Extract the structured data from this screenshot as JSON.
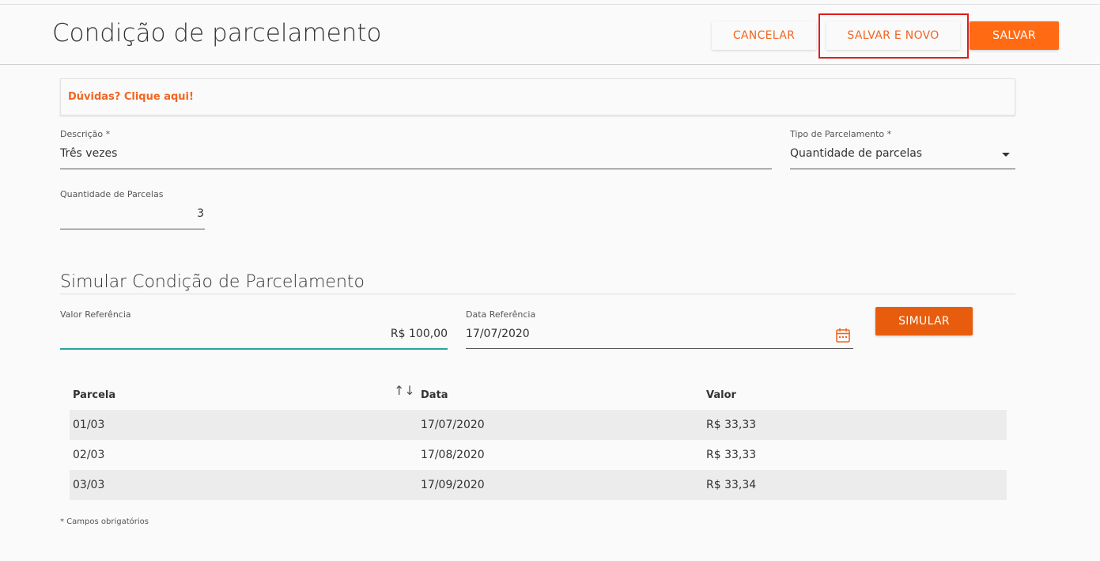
{
  "header": {
    "title": "Condição de parcelamento",
    "buttons": {
      "cancel": "CANCELAR",
      "save_and_new": "SALVAR E NOVO",
      "save": "SALVAR"
    }
  },
  "help": {
    "link_text": "Dúvidas? Clique aqui!"
  },
  "form": {
    "descricao": {
      "label": "Descrição *",
      "value": "Três vezes"
    },
    "tipo_parcelamento": {
      "label": "Tipo de Parcelamento *",
      "value": "Quantidade de parcelas"
    },
    "quantidade_parcelas": {
      "label": "Quantidade de Parcelas",
      "value": "3"
    }
  },
  "simulation": {
    "title": "Simular Condição de Parcelamento",
    "valor_referencia": {
      "label": "Valor Referência",
      "value": "R$ 100,00"
    },
    "data_referencia": {
      "label": "Data Referência",
      "value": "17/07/2020"
    },
    "simulate_button": "SIMULAR"
  },
  "table": {
    "columns": [
      "Parcela",
      "Data",
      "Valor"
    ],
    "rows": [
      [
        "01/03",
        "17/07/2020",
        "R$ 33,33"
      ],
      [
        "02/03",
        "17/08/2020",
        "R$ 33,33"
      ],
      [
        "03/03",
        "17/09/2020",
        "R$ 33,34"
      ]
    ]
  },
  "footer": {
    "required_note": "* Campos obrigatórios"
  },
  "colors": {
    "accent": "#f26522",
    "primary_button": "#ff6a13",
    "simulate_button": "#e85c0d",
    "highlight": "#e31b1b",
    "focus_underline": "#26a69a"
  },
  "icons": {
    "dropdown": "caret-down-icon",
    "calendar": "calendar-icon",
    "sort": "sort-icon"
  }
}
